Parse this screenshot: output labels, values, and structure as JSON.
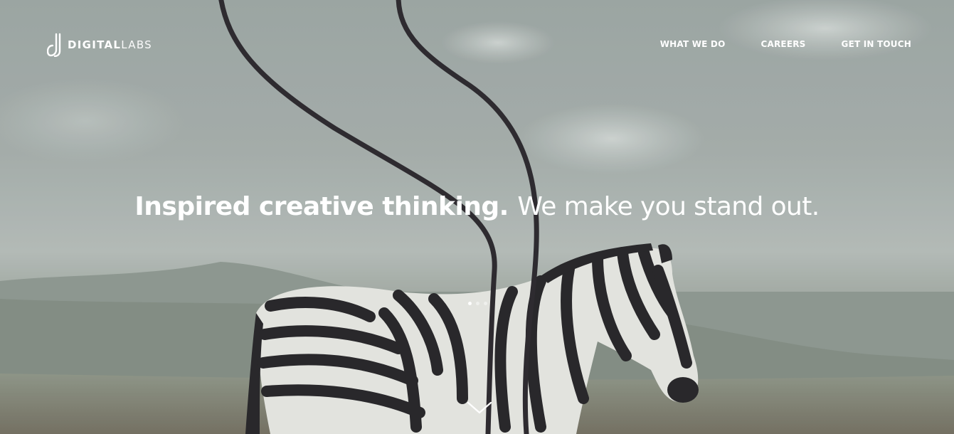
{
  "brand": {
    "name_strong": "DIGITAL",
    "name_light": "LABS"
  },
  "nav": {
    "items": [
      {
        "label": "WHAT WE DO"
      },
      {
        "label": "CAREERS"
      },
      {
        "label": "GET IN TOUCH"
      }
    ]
  },
  "hero": {
    "headline_strong": "Inspired creative thinking.",
    "headline_light": "We make you stand out.",
    "slides": {
      "count": 3,
      "active": 1
    },
    "scroll_icon": "chevron-down-icon"
  },
  "colors": {
    "text": "#ffffff",
    "sky": "#a3aba8",
    "hills": "#7e8a80",
    "ground": "#7c7a6a",
    "zebra_dark": "#1e1c1f",
    "zebra_light": "#e9e9e4"
  }
}
